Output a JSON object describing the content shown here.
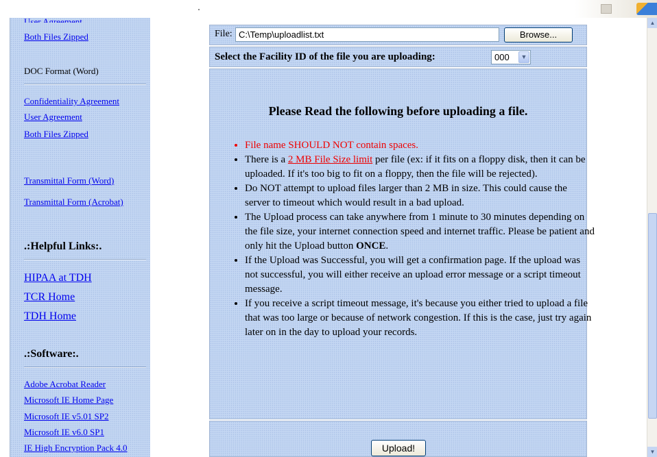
{
  "sidebar": {
    "top_partial_link": "User Agreement",
    "top_zip_link": "Both Files Zipped",
    "doc_format_label": "DOC Format (Word)",
    "doc_links": [
      "Confidentiality Agreement",
      "User Agreement",
      "Both Files Zipped"
    ],
    "transmittal_word": "Transmittal Form (Word)",
    "transmittal_acrobat": "Transmittal Form (Acrobat)",
    "helpful_links_header": ".:Helpful Links:.",
    "helpful_links": [
      "HIPAA at TDH",
      "TCR Home",
      "TDH Home"
    ],
    "software_header": ".:Software:.",
    "software_links": [
      "Adobe Acrobat Reader",
      "Microsoft IE Home Page",
      "Microsoft IE v5.01 SP2",
      "Microsoft IE v6.0 SP1",
      "IE High Encryption Pack 4.0"
    ]
  },
  "upload_form": {
    "file_label": "File:",
    "file_value": "C:\\Temp\\uploadlist.txt",
    "browse_label": "Browse...",
    "facility_label": "Select the Facility ID of the file you are uploading:",
    "facility_value": "000",
    "upload_label": "Upload!"
  },
  "instructions": {
    "heading": "Please Read the following before uploading a file.",
    "item1": "File name SHOULD NOT contain spaces.",
    "item2_pre": "There is a ",
    "item2_link": "2 MB File Size limit",
    "item2_post": " per file (ex: if it fits on a floppy disk, then it can be uploaded. If it's too big to fit on a floppy, then the file will be rejected).",
    "item3": "Do NOT attempt to upload files larger than 2 MB in size. This could cause the server to timeout which would result in a bad upload.",
    "item4_pre": "The Upload process can take anywhere from 1 minute to 30 minutes depending on the file size, your internet connection speed and internet traffic. Please be patient and only hit the Upload button ",
    "item4_emph": "ONCE",
    "item4_post": ".",
    "item5": "If the Upload was Successful, you will get a confirmation page. If the upload was not successful, you will either receive an upload error message or a script timeout message.",
    "item6": "If you receive a script timeout message, it's because you either tried to upload a file that was too large or because of network congestion. If this is the case, just try again later on in the day to upload your records."
  },
  "colors": {
    "panel_bg": "#c3d6f2",
    "link": "#0000ee",
    "warning": "#ee0000"
  }
}
